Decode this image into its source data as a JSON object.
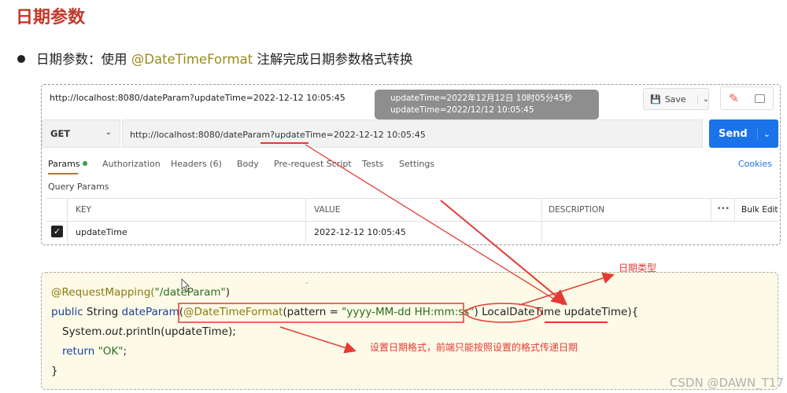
{
  "slide": {
    "title": "日期参数",
    "bullet_prefix": "日期参数：使用 ",
    "bullet_annotation": "@DateTimeFormat",
    "bullet_suffix": " 注解完成日期参数格式转换"
  },
  "postman": {
    "request_title": "http://localhost:8080/dateParam?updateTime=2022-12-12 10:05:45",
    "save_label": "Save",
    "method": "GET",
    "url": "http://localhost:8080/dateParam?updateTime=2022-12-12 10:05:45",
    "send_label": "Send",
    "tabs": [
      {
        "label": "Params",
        "active": true
      },
      {
        "label": "Authorization"
      },
      {
        "label": "Headers (6)"
      },
      {
        "label": "Body"
      },
      {
        "label": "Pre-request Script"
      },
      {
        "label": "Tests"
      },
      {
        "label": "Settings"
      }
    ],
    "cookies_label": "Cookies",
    "query_params_label": "Query Params",
    "table": {
      "headers": [
        "KEY",
        "VALUE",
        "DESCRIPTION",
        "•••",
        "Bulk Edit"
      ],
      "rows": [
        {
          "checked": true,
          "key": "updateTime",
          "value": "2022-12-12 10:05:45",
          "description": ""
        }
      ]
    },
    "tooltip_lines": [
      "updateTime=2022年12月12日 10时05分45秒",
      "updateTime=2022/12/12 10:05:45"
    ]
  },
  "code": {
    "line1_annotation": "@RequestMapping(",
    "line1_string": "\"/dateParam\"",
    "line1_end": ")",
    "line2_kw": "public",
    "line2_type": " String ",
    "line2_method": "dateParam",
    "line2_paren": "(",
    "line2_annotation": "@DateTimeFormat",
    "line2_pattern_open": "(pattern = ",
    "line2_pattern": "\"yyyy-MM-dd HH:mm:ss\"",
    "line2_pattern_close": ")",
    "line2_param_type": " LocalDateTime ",
    "line2_param_name": "updateTime",
    "line2_end": "){",
    "line3_a": "System.",
    "line3_out": "out",
    "line3_b": ".println(updateTime);",
    "line4_kw": "return",
    "line4_str": " \"OK\"",
    "line4_end": ";",
    "line5": "}",
    "dash_mark": "-"
  },
  "annotations": {
    "date_type": "日期类型",
    "format_note": "设置日期格式，前端只能按照设置的格式传递日期",
    "accent_color": "#e53935"
  },
  "watermark": "CSDN @DAWN_T17"
}
